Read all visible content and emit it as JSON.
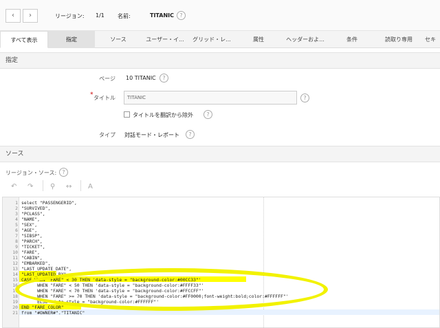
{
  "header": {
    "region_label": "リージョン:",
    "region_count": "1/1",
    "name_label": "名前:",
    "name_value": "TITANIC",
    "help": "?"
  },
  "tabs": [
    {
      "label": "すべて表示"
    },
    {
      "label": "指定"
    },
    {
      "label": "ソース"
    },
    {
      "label": "ユーザー・イ..."
    },
    {
      "label": "グリッド・レ..."
    },
    {
      "label": "属性"
    },
    {
      "label": "ヘッダーおよ..."
    },
    {
      "label": "条件"
    },
    {
      "label": "読取り専用"
    },
    {
      "label": "セキ"
    }
  ],
  "identification": {
    "section_title": "指定",
    "page_label": "ページ",
    "page_value": "10 TITANIC",
    "title_label": "タイトル",
    "title_value": "TITANIC",
    "exclude_label": "タイトルを翻訳から除外",
    "type_label": "タイプ",
    "type_value": "対話モード・レポート"
  },
  "source": {
    "section_title": "ソース",
    "region_source_label": "リージョン・ソース:",
    "toolbar": {
      "undo": "↶",
      "redo": "↷",
      "search": "⚲",
      "replace": "↔",
      "format": "A"
    },
    "code_lines": [
      {
        "n": "1",
        "text": "select \"PASSENGERID\","
      },
      {
        "n": "2",
        "text": "\"SURVIVED\","
      },
      {
        "n": "3",
        "text": "\"PCLASS\","
      },
      {
        "n": "4",
        "text": "\"NAME\","
      },
      {
        "n": "5",
        "text": "\"SEX\","
      },
      {
        "n": "6",
        "text": "\"AGE\","
      },
      {
        "n": "7",
        "text": "\"SIBSP\","
      },
      {
        "n": "8",
        "text": "\"PARCH\","
      },
      {
        "n": "9",
        "text": "\"TICKET\","
      },
      {
        "n": "10",
        "text": "\"FARE\","
      },
      {
        "n": "11",
        "text": "\"CABIN\","
      },
      {
        "n": "12",
        "text": "\"EMBARKED\","
      },
      {
        "n": "13",
        "text": "\"LAST_UPDATE_DATE\","
      },
      {
        "n": "14",
        "text": "\"LAST_UPDATED_BY\","
      },
      {
        "n": "15",
        "text": "CASE WHEN \"FARE\" < 30 THEN 'data-style = \"background-color:#00CC33\"'"
      },
      {
        "n": "16",
        "text": "      WHEN \"FARE\" < 50 THEN 'data-style = \"background-color:#FFFF33\"'"
      },
      {
        "n": "17",
        "text": "      WHEN \"FARE\" < 70 THEN 'data-style = \"background-color:#FFCCFF\"'"
      },
      {
        "n": "18",
        "text": "      WHEN \"FARE\" >= 70 THEN 'data-style = \"background-color:#FF0000;font-weight:bold;color:#FFFFFF\"'"
      },
      {
        "n": "19",
        "text": "      ELSE 'data-style = \"background-color:#FFFFFF\"'"
      },
      {
        "n": "20",
        "text": "END \"FARE_COLOR\""
      },
      {
        "n": "21",
        "text": "from \"#OWNER#\".\"TITANIC\""
      }
    ]
  },
  "colors": {
    "annotation_yellow": "#f2f200",
    "required_star": "#cc0000"
  }
}
